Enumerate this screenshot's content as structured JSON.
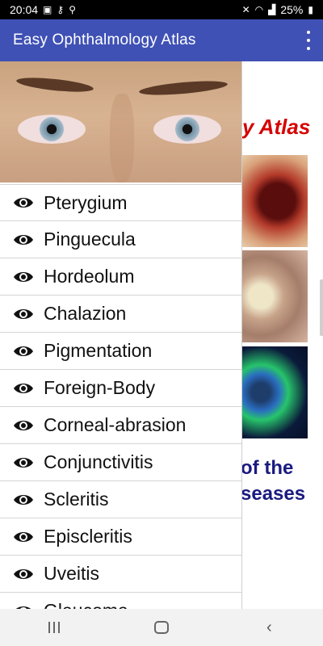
{
  "status_bar": {
    "time": "20:04",
    "battery": "25%"
  },
  "app_bar": {
    "title": "Easy Ophthalmology Atlas"
  },
  "background": {
    "title_fragment": "y Atlas",
    "subtitle_line1": "of the",
    "subtitle_line2": "seases"
  },
  "drawer": {
    "items": [
      {
        "label": "Pterygium"
      },
      {
        "label": "Pinguecula"
      },
      {
        "label": "Hordeolum"
      },
      {
        "label": "Chalazion"
      },
      {
        "label": "Pigmentation"
      },
      {
        "label": "Foreign-Body"
      },
      {
        "label": "Corneal-abrasion"
      },
      {
        "label": "Conjunctivitis"
      },
      {
        "label": "Scleritis"
      },
      {
        "label": "Episcleritis"
      },
      {
        "label": "Uveitis"
      },
      {
        "label": "Glaucoma"
      }
    ]
  },
  "colors": {
    "app_bar": "#3f51b5",
    "title_red": "#d60000",
    "subtitle_blue": "#1a1a80"
  }
}
